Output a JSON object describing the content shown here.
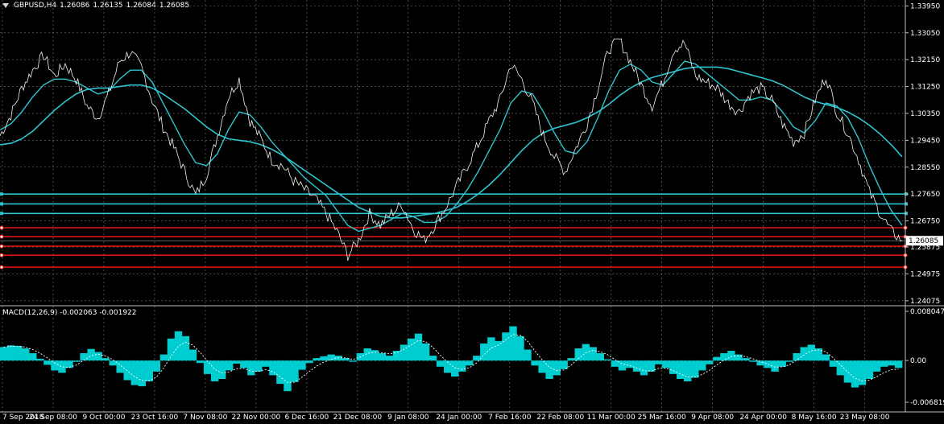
{
  "header": {
    "symbol_tf": "GBPUSD,H4",
    "open": "1.26086",
    "high": "1.26135",
    "low": "1.26084",
    "close": "1.26085"
  },
  "macd_header": {
    "label": "MACD(12,26,9)",
    "main": "-0.002063",
    "signal": "-0.001922"
  },
  "colors": {
    "background": "#000000",
    "price_line": "#f2f2f2",
    "ma": "#2ec4d0",
    "support_cyan": "#2ec4d0",
    "resistance_red": "#ff1a1a",
    "macd_hist": "#00cdd0",
    "grid": "#7a7a7a"
  },
  "chart_data": [
    {
      "type": "line",
      "title": "GBPUSD,H4",
      "ylim": [
        1.2407,
        1.3396
      ],
      "price_ticks": [
        "1.33950",
        "1.33050",
        "1.32150",
        "1.31250",
        "1.30350",
        "1.29450",
        "1.28550",
        "1.27650",
        "1.26750",
        "1.25875",
        "1.24975",
        "1.24075"
      ],
      "current_price": "1.26085",
      "x_labels": [
        "7 Sep 2018",
        "24 Sep 08:00",
        "9 Oct 00:00",
        "23 Oct 16:00",
        "7 Nov 08:00",
        "22 Nov 00:00",
        "6 Dec 16:00",
        "21 Dec 08:00",
        "9 Jan 08:00",
        "24 Jan 00:00",
        "7 Feb 16:00",
        "22 Feb 08:00",
        "11 Mar 00:00",
        "25 Mar 16:00",
        "9 Apr 08:00",
        "24 Apr 00:00",
        "8 May 16:00",
        "23 May 08:00"
      ],
      "price_series": [
        1.296,
        1.303,
        1.312,
        1.318,
        1.323,
        1.316,
        1.32,
        1.315,
        1.306,
        1.302,
        1.31,
        1.321,
        1.324,
        1.319,
        1.308,
        1.299,
        1.292,
        1.284,
        1.276,
        1.283,
        1.296,
        1.309,
        1.315,
        1.301,
        1.295,
        1.288,
        1.286,
        1.281,
        1.278,
        1.275,
        1.27,
        1.264,
        1.256,
        1.261,
        1.27,
        1.266,
        1.27,
        1.273,
        1.265,
        1.261,
        1.266,
        1.272,
        1.279,
        1.286,
        1.293,
        1.301,
        1.308,
        1.32,
        1.315,
        1.307,
        1.296,
        1.289,
        1.284,
        1.292,
        1.3,
        1.312,
        1.325,
        1.328,
        1.321,
        1.313,
        1.306,
        1.314,
        1.325,
        1.327,
        1.316,
        1.314,
        1.312,
        1.307,
        1.304,
        1.31,
        1.312,
        1.308,
        1.3,
        1.294,
        1.297,
        1.308,
        1.316,
        1.304,
        1.297,
        1.288,
        1.277,
        1.27,
        1.264,
        1.261
      ],
      "ma_fast": [
        1.298,
        1.3,
        1.304,
        1.309,
        1.313,
        1.315,
        1.315,
        1.314,
        1.312,
        1.31,
        1.311,
        1.315,
        1.318,
        1.318,
        1.314,
        1.307,
        1.3,
        1.293,
        1.287,
        1.286,
        1.29,
        1.298,
        1.304,
        1.303,
        1.299,
        1.294,
        1.29,
        1.286,
        1.282,
        1.279,
        1.276,
        1.271,
        1.266,
        1.264,
        1.265,
        1.266,
        1.268,
        1.27,
        1.269,
        1.267,
        1.267,
        1.269,
        1.273,
        1.278,
        1.284,
        1.291,
        1.298,
        1.307,
        1.311,
        1.31,
        1.304,
        1.297,
        1.291,
        1.29,
        1.294,
        1.302,
        1.311,
        1.318,
        1.32,
        1.318,
        1.314,
        1.313,
        1.317,
        1.321,
        1.32,
        1.317,
        1.314,
        1.311,
        1.308,
        1.308,
        1.309,
        1.308,
        1.304,
        1.299,
        1.297,
        1.301,
        1.307,
        1.306,
        1.302,
        1.295,
        1.286,
        1.278,
        1.271,
        1.266
      ],
      "ma_slow": [
        1.293,
        1.2935,
        1.295,
        1.2975,
        1.301,
        1.3045,
        1.3075,
        1.31,
        1.3115,
        1.312,
        1.312,
        1.3125,
        1.313,
        1.313,
        1.312,
        1.31,
        1.3075,
        1.305,
        1.302,
        1.299,
        1.2965,
        1.295,
        1.2945,
        1.294,
        1.293,
        1.2915,
        1.2895,
        1.287,
        1.2845,
        1.282,
        1.2795,
        1.277,
        1.2745,
        1.272,
        1.2705,
        1.269,
        1.2685,
        1.2685,
        1.269,
        1.2695,
        1.27,
        1.271,
        1.272,
        1.274,
        1.2765,
        1.2795,
        1.283,
        1.287,
        1.291,
        1.2945,
        1.297,
        1.2985,
        1.2995,
        1.3005,
        1.302,
        1.304,
        1.3065,
        1.3095,
        1.312,
        1.314,
        1.3155,
        1.3165,
        1.3175,
        1.3185,
        1.319,
        1.319,
        1.319,
        1.3185,
        1.3175,
        1.3165,
        1.3155,
        1.3145,
        1.313,
        1.311,
        1.309,
        1.3075,
        1.3065,
        1.3055,
        1.304,
        1.302,
        1.2995,
        1.2965,
        1.293,
        1.289
      ],
      "cyan_levels": [
        1.2765,
        1.2732,
        1.27
      ],
      "red_levels": [
        1.2652,
        1.2622,
        1.259,
        1.256,
        1.252
      ]
    },
    {
      "type": "bar",
      "title": "MACD(12,26,9)",
      "ylim": [
        -0.006819,
        0.008047
      ],
      "ticks": [
        "0.008047",
        "0.00",
        "-0.006819"
      ],
      "histogram": [
        0.0022,
        0.0025,
        0.0024,
        0.002,
        0.0012,
        0.0003,
        -0.0007,
        -0.0016,
        -0.002,
        -0.0012,
        -0.0002,
        0.0012,
        0.0019,
        0.0014,
        0.0004,
        -0.0008,
        -0.002,
        -0.0032,
        -0.004,
        -0.0042,
        -0.0034,
        -0.0018,
        0.001,
        0.0036,
        0.0048,
        0.004,
        0.0018,
        -0.0004,
        -0.0022,
        -0.0034,
        -0.003,
        -0.0016,
        -0.0005,
        -0.0012,
        -0.0024,
        -0.0018,
        -0.001,
        -0.0024,
        -0.0038,
        -0.005,
        -0.0035,
        -0.0015,
        -0.0004,
        0.0004,
        0.0007,
        0.001,
        0.0008,
        0.0004,
        -0.0002,
        0.0012,
        0.002,
        0.0017,
        0.0012,
        0.0008,
        0.0016,
        0.0026,
        0.0036,
        0.0044,
        0.0028,
        0.0008,
        -0.001,
        -0.002,
        -0.0026,
        -0.0018,
        -0.0008,
        0.0008,
        0.0028,
        0.0038,
        0.0032,
        0.0046,
        0.0056,
        0.004,
        0.0018,
        -0.0008,
        -0.002,
        -0.003,
        -0.0024,
        -0.0014,
        0.0004,
        0.002,
        0.0027,
        0.0022,
        0.0012,
        0.0002,
        -0.001,
        -0.0016,
        -0.0012,
        -0.0018,
        -0.0024,
        -0.0018,
        -0.0006,
        -0.0012,
        -0.0022,
        -0.003,
        -0.0034,
        -0.0028,
        -0.0016,
        -0.0006,
        0.0006,
        0.0012,
        0.0016,
        0.001,
        0.0004,
        -0.0002,
        -0.0008,
        -0.0012,
        -0.0018,
        -0.001,
        -0.0002,
        0.0012,
        0.0022,
        0.0026,
        0.002,
        0.001,
        -0.001,
        -0.0024,
        -0.0036,
        -0.0044,
        -0.004,
        -0.003,
        -0.0018,
        -0.001,
        -0.0008,
        -0.0012
      ]
    }
  ]
}
